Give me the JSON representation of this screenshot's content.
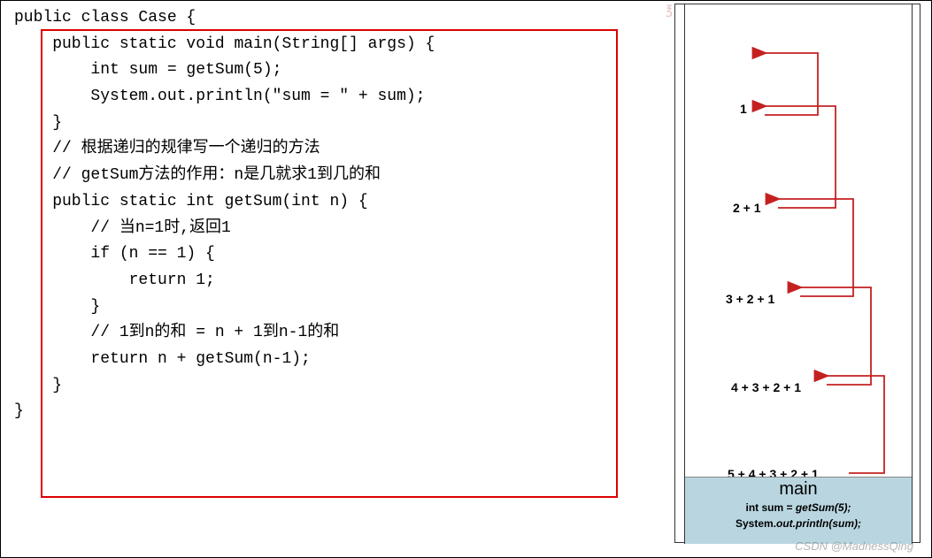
{
  "code": {
    "line1": "public class Case {",
    "line2": "    public static void main(String[] args) {",
    "line3": "        int sum = getSum(5);",
    "line4": "        System.out.println(\"sum = \" + sum);",
    "line5": "    }",
    "line6": "    // 根据递归的规律写一个递归的方法",
    "line7": "    // getSum方法的作用：n是几就求1到几的和",
    "line8": "    public static int getSum(int n) {",
    "line9": "        // 当n=1时,返回1",
    "line10": "        if (n == 1) {",
    "line11": "            return 1;",
    "line12": "        }",
    "line13": "        // 1到n的和 = n + 1到n-1的和",
    "line14": "        return n + getSum(n-1);",
    "line15": "    }",
    "line16": "}"
  },
  "stack": {
    "l1": "1",
    "l2": "2 + 1",
    "l3": "3 + 2 + 1",
    "l4": "4 + 3 + 2 + 1",
    "l5": "5 + 4 + 3 + 2 + 1"
  },
  "main": {
    "title": "main",
    "line1a": "int sum = ",
    "line1b": "getSum(5);",
    "line2a": "System.",
    "line2b": "out.println(sum);"
  },
  "watermark": "CSDN @MadnessQing"
}
